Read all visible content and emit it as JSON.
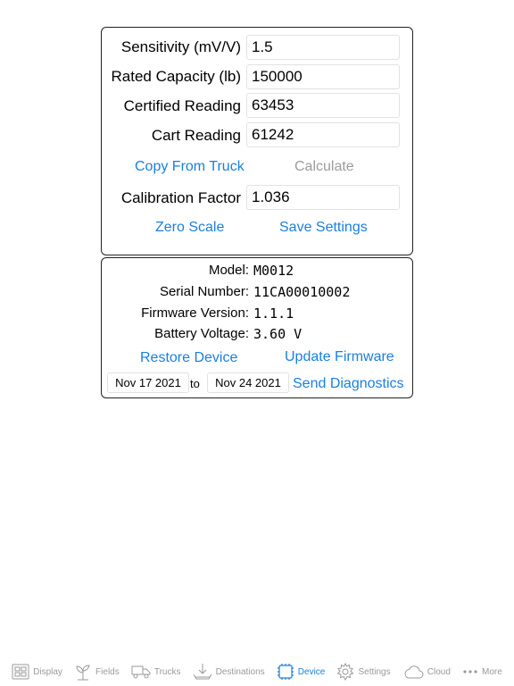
{
  "settings": {
    "sensitivity": {
      "label": "Sensitivity (mV/V)",
      "value": "1.5"
    },
    "rated_capacity": {
      "label": "Rated Capacity (lb)",
      "value": "150000"
    },
    "certified_reading": {
      "label": "Certified Reading",
      "value": "63453"
    },
    "cart_reading": {
      "label": "Cart Reading",
      "value": "61242"
    },
    "copy_from_truck": "Copy From Truck",
    "calculate": "Calculate",
    "calibration_factor": {
      "label": "Calibration Factor",
      "value": "1.036"
    },
    "zero_scale": "Zero Scale",
    "save_settings": "Save Settings"
  },
  "device": {
    "model": {
      "label": "Model:",
      "value": "M0012"
    },
    "serial": {
      "label": "Serial Number:",
      "value": "11CA00010002"
    },
    "firmware": {
      "label": "Firmware Version:",
      "value": "1.1.1"
    },
    "battery": {
      "label": "Battery Voltage:",
      "value": "3.60 V"
    },
    "restore_device": "Restore Device",
    "update_firmware": "Update Firmware",
    "date_from": "Nov 17 2021",
    "date_to_sep": "to",
    "date_to": "Nov 24 2021",
    "send_diagnostics": "Send Diagnostics"
  },
  "tabs": [
    {
      "label": "Display",
      "icon": "display-grid-icon"
    },
    {
      "label": "Fields",
      "icon": "plant-icon"
    },
    {
      "label": "Trucks",
      "icon": "truck-icon"
    },
    {
      "label": "Destinations",
      "icon": "download-tray-icon"
    },
    {
      "label": "Device",
      "icon": "chip-icon"
    },
    {
      "label": "Settings",
      "icon": "gear-icon"
    },
    {
      "label": "Cloud",
      "icon": "cloud-icon"
    },
    {
      "label": "More",
      "icon": "more-dots-icon"
    }
  ],
  "active_tab": "Device",
  "colors": {
    "accent": "#1a7fe0",
    "inactive": "#9a9a9a",
    "disabled": "#9c9c9c"
  }
}
